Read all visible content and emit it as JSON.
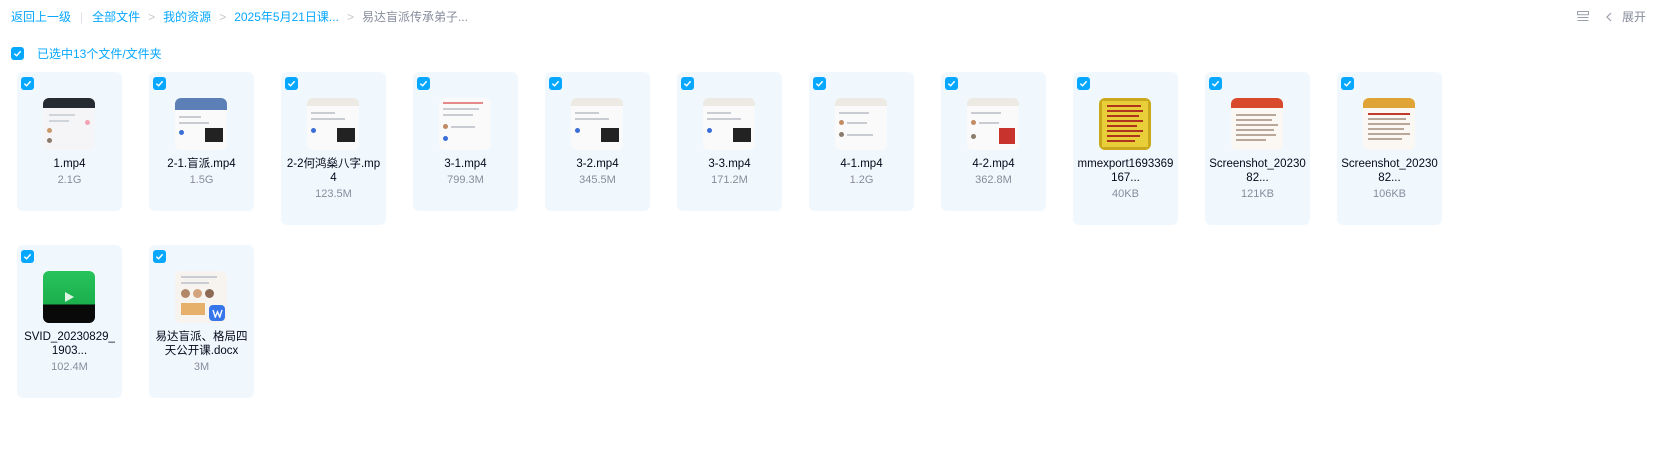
{
  "breadcrumb": {
    "back_label": "返回上一级",
    "items": [
      "全部文件",
      "我的资源",
      "2025年5月21日课...",
      "易达盲派传承弟子..."
    ]
  },
  "toolbar": {
    "expand_label": "展开"
  },
  "selection": {
    "label": "已选中13个文件/文件夹"
  },
  "files": [
    {
      "name": "1.mp4",
      "size": "2.1G",
      "thumb": "video"
    },
    {
      "name": "2-1.盲派.mp4",
      "size": "1.5G",
      "thumb": "video"
    },
    {
      "name": "2-2何鸿燊八字.mp4",
      "size": "123.5M",
      "thumb": "video"
    },
    {
      "name": "3-1.mp4",
      "size": "799.3M",
      "thumb": "video"
    },
    {
      "name": "3-2.mp4",
      "size": "345.5M",
      "thumb": "video"
    },
    {
      "name": "3-3.mp4",
      "size": "171.2M",
      "thumb": "video"
    },
    {
      "name": "4-1.mp4",
      "size": "1.2G",
      "thumb": "video"
    },
    {
      "name": "4-2.mp4",
      "size": "362.8M",
      "thumb": "video"
    },
    {
      "name": "mmexport1693369167...",
      "size": "40KB",
      "thumb": "image"
    },
    {
      "name": "Screenshot_2023082...",
      "size": "121KB",
      "thumb": "image"
    },
    {
      "name": "Screenshot_2023082...",
      "size": "106KB",
      "thumb": "image"
    },
    {
      "name": "SVID_20230829_1903...",
      "size": "102.4M",
      "thumb": "video"
    },
    {
      "name": "易达盲派、格局四天公开课.docx",
      "size": "3M",
      "thumb": "docx"
    }
  ],
  "colors": {
    "accent": "#06a7ff",
    "card_bg": "#f1f8fd",
    "muted": "#878c9c",
    "text": "#03081a"
  }
}
